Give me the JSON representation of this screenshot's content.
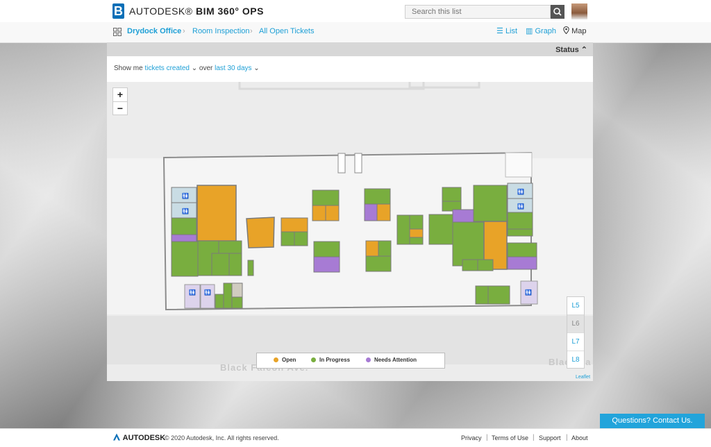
{
  "header": {
    "logo_letter": "B",
    "brand_prefix": "AUTODESK®",
    "brand_product": "BIM 360° OPS",
    "search_placeholder": "Search this list"
  },
  "breadcrumb": {
    "items": [
      "Drydock Office",
      "Room Inspection",
      "All Open Tickets"
    ]
  },
  "views": {
    "list_label": "List",
    "graph_label": "Graph",
    "map_label": "Map"
  },
  "status_toggle": {
    "label": "Status",
    "icon": "chevron-up-icon"
  },
  "filter": {
    "prefix": "Show me",
    "metric": "tickets created",
    "middle": "over",
    "range": "last 30 days"
  },
  "map": {
    "zoom_in": "+",
    "zoom_out": "−",
    "street_label": "Black Falcon Ave.",
    "street_label_right": "Black Fa",
    "attribution": "Leaflet",
    "levels": [
      "L5",
      "L6",
      "L7",
      "L8"
    ],
    "selected_level": "L6"
  },
  "legend": {
    "items": [
      {
        "label": "Open",
        "color": "#e8a328"
      },
      {
        "label": "In Progress",
        "color": "#79ae3f"
      },
      {
        "label": "Needs Attention",
        "color": "#a77bd4"
      }
    ]
  },
  "colors": {
    "accent": "#1d9fd6",
    "open": "#e8a328",
    "in_progress": "#79ae3f",
    "needs_attention": "#a77bd4",
    "restroom": "#c9dce4"
  },
  "contact_button": "Questions? Contact Us.",
  "footer": {
    "logo": "AUTODESK",
    "copyright": "© 2020 Autodesk, Inc. All rights reserved.",
    "links": [
      "Privacy",
      "Terms of Use",
      "Support",
      "About"
    ]
  }
}
